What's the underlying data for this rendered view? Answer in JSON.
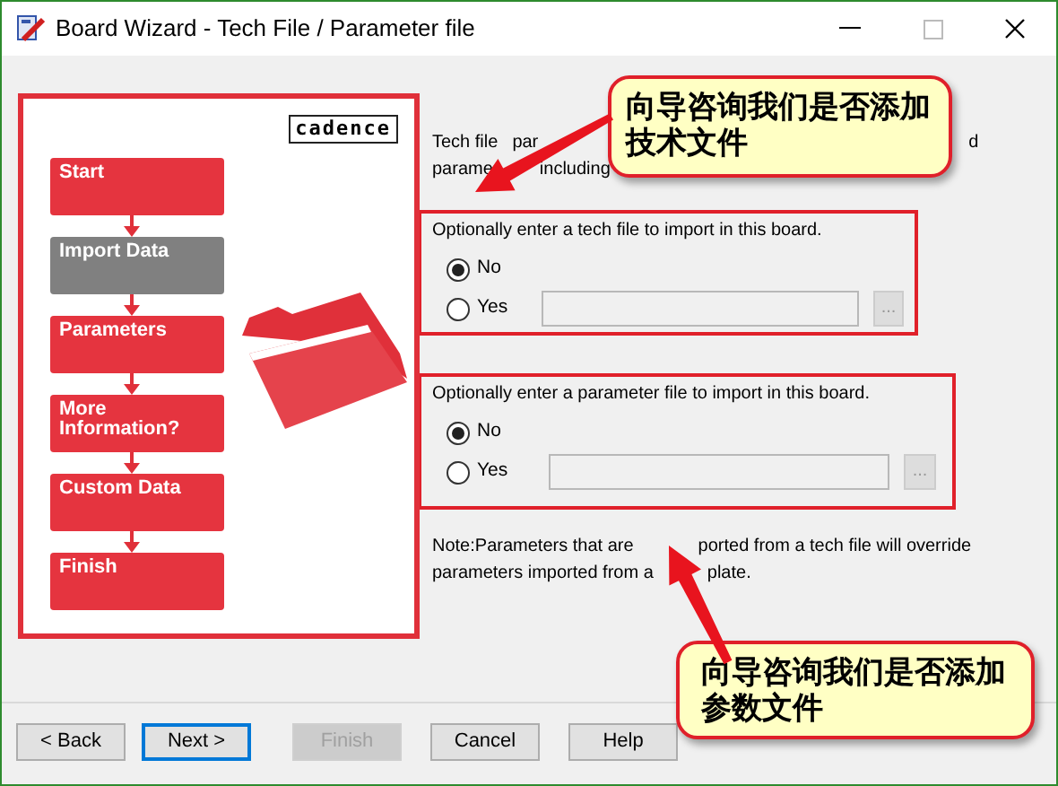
{
  "window": {
    "title": "Board Wizard - Tech File / Parameter file"
  },
  "logo": "cadence",
  "steps": [
    {
      "label": "Start",
      "selected": false
    },
    {
      "label": "Import Data",
      "selected": true
    },
    {
      "label": "Parameters",
      "selected": false
    },
    {
      "label": "More Information?",
      "selected": false
    },
    {
      "label": "Custom Data",
      "selected": false
    },
    {
      "label": "Finish",
      "selected": false
    }
  ],
  "intro": [
    [
      "Tech file",
      "par",
      "d"
    ],
    [
      "parame",
      "including"
    ]
  ],
  "groups": [
    {
      "prompt": "Optionally enter a tech file to import in this board.",
      "options": [
        {
          "label": "No",
          "selected": true
        },
        {
          "label": "Yes",
          "selected": false
        }
      ],
      "browse_label": "..."
    },
    {
      "prompt": "Optionally enter a parameter file to import in this board.",
      "options": [
        {
          "label": "No",
          "selected": true
        },
        {
          "label": "Yes",
          "selected": false
        }
      ],
      "browse_label": "..."
    }
  ],
  "note": [
    [
      "Note:Parameters that are",
      "ported from a tech file will override"
    ],
    [
      "parameters imported from a",
      "plate."
    ]
  ],
  "callouts": [
    {
      "lines": [
        "向导咨询我们是否添加",
        "技术文件"
      ]
    },
    {
      "lines": [
        "向导咨询我们是否添加",
        "参数文件"
      ]
    }
  ],
  "buttons": [
    {
      "label": "< Back",
      "kind": "normal"
    },
    {
      "label": "Next >",
      "kind": "default"
    },
    {
      "label": "Finish",
      "kind": "disabled"
    },
    {
      "label": "Cancel",
      "kind": "normal"
    },
    {
      "label": "Help",
      "kind": "normal"
    }
  ]
}
